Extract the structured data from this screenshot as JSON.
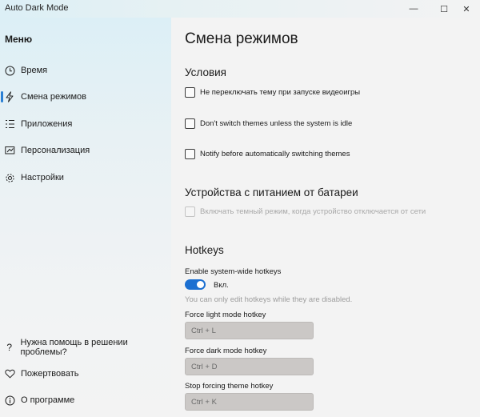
{
  "window": {
    "title": "Auto Dark Mode",
    "minimize_glyph": "—",
    "maximize_glyph": "☐",
    "close_glyph": "✕"
  },
  "sidebar": {
    "menu_title": "Меню",
    "items": [
      {
        "label": "Время",
        "icon": "clock-icon"
      },
      {
        "label": "Смена режимов",
        "icon": "lightning-icon",
        "active": true
      },
      {
        "label": "Приложения",
        "icon": "list-icon"
      },
      {
        "label": "Персонализация",
        "icon": "personalize-icon"
      },
      {
        "label": "Настройки",
        "icon": "gear-icon"
      }
    ],
    "footer": [
      {
        "label": "Нужна помощь в решении проблемы?",
        "icon": "question-icon"
      },
      {
        "label": "Пожертвовать",
        "icon": "heart-icon"
      },
      {
        "label": "О программе",
        "icon": "info-icon"
      }
    ]
  },
  "main": {
    "title": "Смена режимов",
    "conditions": {
      "heading": "Условия",
      "options": [
        {
          "label": "Не переключать тему при запуске видеоигры",
          "checked": false
        },
        {
          "label": "Don't switch themes unless the system is idle",
          "checked": false
        },
        {
          "label": "Notify before automatically switching themes",
          "checked": false
        }
      ]
    },
    "battery": {
      "heading": "Устройства с питанием от батареи",
      "option": {
        "label": "Включать темный режим, когда устройство отключается от сети",
        "checked": false,
        "disabled": true
      }
    },
    "hotkeys": {
      "heading": "Hotkeys",
      "enable_label": "Enable system-wide hotkeys",
      "toggle_state": "Вкл.",
      "toggle_on": true,
      "hint": "You can only edit hotkeys while they are disabled.",
      "fields": [
        {
          "label": "Force light mode hotkey",
          "value": "Ctrl + L"
        },
        {
          "label": "Force dark mode hotkey",
          "value": "Ctrl + D"
        },
        {
          "label": "Stop forcing theme hotkey",
          "value": "Ctrl + K"
        }
      ]
    }
  },
  "colors": {
    "accent": "#1b6fd1",
    "active_indicator": "#2a7fd4",
    "hotkey_field_bg": "#cbc8c6"
  }
}
